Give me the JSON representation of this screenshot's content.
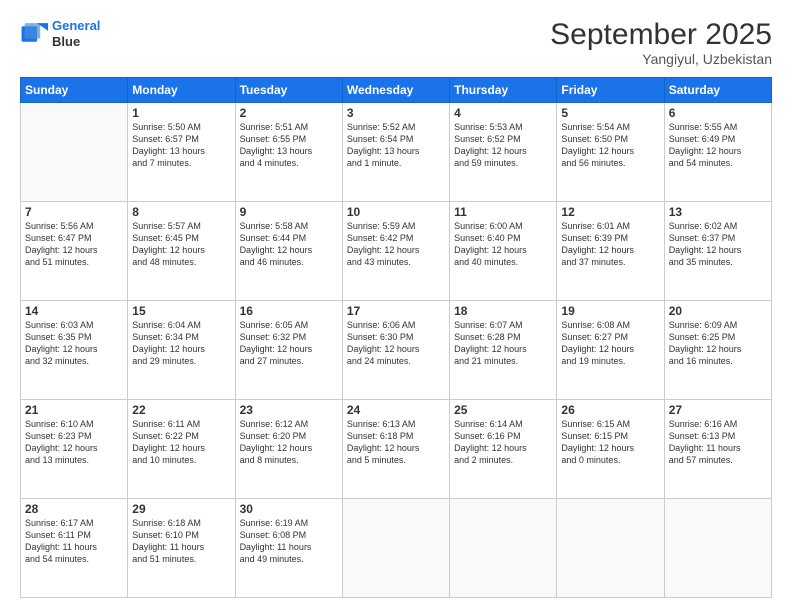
{
  "logo": {
    "line1": "General",
    "line2": "Blue"
  },
  "header": {
    "month": "September 2025",
    "location": "Yangiyul, Uzbekistan"
  },
  "weekdays": [
    "Sunday",
    "Monday",
    "Tuesday",
    "Wednesday",
    "Thursday",
    "Friday",
    "Saturday"
  ],
  "weeks": [
    [
      {
        "day": "",
        "info": ""
      },
      {
        "day": "1",
        "info": "Sunrise: 5:50 AM\nSunset: 6:57 PM\nDaylight: 13 hours\nand 7 minutes."
      },
      {
        "day": "2",
        "info": "Sunrise: 5:51 AM\nSunset: 6:55 PM\nDaylight: 13 hours\nand 4 minutes."
      },
      {
        "day": "3",
        "info": "Sunrise: 5:52 AM\nSunset: 6:54 PM\nDaylight: 13 hours\nand 1 minute."
      },
      {
        "day": "4",
        "info": "Sunrise: 5:53 AM\nSunset: 6:52 PM\nDaylight: 12 hours\nand 59 minutes."
      },
      {
        "day": "5",
        "info": "Sunrise: 5:54 AM\nSunset: 6:50 PM\nDaylight: 12 hours\nand 56 minutes."
      },
      {
        "day": "6",
        "info": "Sunrise: 5:55 AM\nSunset: 6:49 PM\nDaylight: 12 hours\nand 54 minutes."
      }
    ],
    [
      {
        "day": "7",
        "info": "Sunrise: 5:56 AM\nSunset: 6:47 PM\nDaylight: 12 hours\nand 51 minutes."
      },
      {
        "day": "8",
        "info": "Sunrise: 5:57 AM\nSunset: 6:45 PM\nDaylight: 12 hours\nand 48 minutes."
      },
      {
        "day": "9",
        "info": "Sunrise: 5:58 AM\nSunset: 6:44 PM\nDaylight: 12 hours\nand 46 minutes."
      },
      {
        "day": "10",
        "info": "Sunrise: 5:59 AM\nSunset: 6:42 PM\nDaylight: 12 hours\nand 43 minutes."
      },
      {
        "day": "11",
        "info": "Sunrise: 6:00 AM\nSunset: 6:40 PM\nDaylight: 12 hours\nand 40 minutes."
      },
      {
        "day": "12",
        "info": "Sunrise: 6:01 AM\nSunset: 6:39 PM\nDaylight: 12 hours\nand 37 minutes."
      },
      {
        "day": "13",
        "info": "Sunrise: 6:02 AM\nSunset: 6:37 PM\nDaylight: 12 hours\nand 35 minutes."
      }
    ],
    [
      {
        "day": "14",
        "info": "Sunrise: 6:03 AM\nSunset: 6:35 PM\nDaylight: 12 hours\nand 32 minutes."
      },
      {
        "day": "15",
        "info": "Sunrise: 6:04 AM\nSunset: 6:34 PM\nDaylight: 12 hours\nand 29 minutes."
      },
      {
        "day": "16",
        "info": "Sunrise: 6:05 AM\nSunset: 6:32 PM\nDaylight: 12 hours\nand 27 minutes."
      },
      {
        "day": "17",
        "info": "Sunrise: 6:06 AM\nSunset: 6:30 PM\nDaylight: 12 hours\nand 24 minutes."
      },
      {
        "day": "18",
        "info": "Sunrise: 6:07 AM\nSunset: 6:28 PM\nDaylight: 12 hours\nand 21 minutes."
      },
      {
        "day": "19",
        "info": "Sunrise: 6:08 AM\nSunset: 6:27 PM\nDaylight: 12 hours\nand 19 minutes."
      },
      {
        "day": "20",
        "info": "Sunrise: 6:09 AM\nSunset: 6:25 PM\nDaylight: 12 hours\nand 16 minutes."
      }
    ],
    [
      {
        "day": "21",
        "info": "Sunrise: 6:10 AM\nSunset: 6:23 PM\nDaylight: 12 hours\nand 13 minutes."
      },
      {
        "day": "22",
        "info": "Sunrise: 6:11 AM\nSunset: 6:22 PM\nDaylight: 12 hours\nand 10 minutes."
      },
      {
        "day": "23",
        "info": "Sunrise: 6:12 AM\nSunset: 6:20 PM\nDaylight: 12 hours\nand 8 minutes."
      },
      {
        "day": "24",
        "info": "Sunrise: 6:13 AM\nSunset: 6:18 PM\nDaylight: 12 hours\nand 5 minutes."
      },
      {
        "day": "25",
        "info": "Sunrise: 6:14 AM\nSunset: 6:16 PM\nDaylight: 12 hours\nand 2 minutes."
      },
      {
        "day": "26",
        "info": "Sunrise: 6:15 AM\nSunset: 6:15 PM\nDaylight: 12 hours\nand 0 minutes."
      },
      {
        "day": "27",
        "info": "Sunrise: 6:16 AM\nSunset: 6:13 PM\nDaylight: 11 hours\nand 57 minutes."
      }
    ],
    [
      {
        "day": "28",
        "info": "Sunrise: 6:17 AM\nSunset: 6:11 PM\nDaylight: 11 hours\nand 54 minutes."
      },
      {
        "day": "29",
        "info": "Sunrise: 6:18 AM\nSunset: 6:10 PM\nDaylight: 11 hours\nand 51 minutes."
      },
      {
        "day": "30",
        "info": "Sunrise: 6:19 AM\nSunset: 6:08 PM\nDaylight: 11 hours\nand 49 minutes."
      },
      {
        "day": "",
        "info": ""
      },
      {
        "day": "",
        "info": ""
      },
      {
        "day": "",
        "info": ""
      },
      {
        "day": "",
        "info": ""
      }
    ]
  ]
}
